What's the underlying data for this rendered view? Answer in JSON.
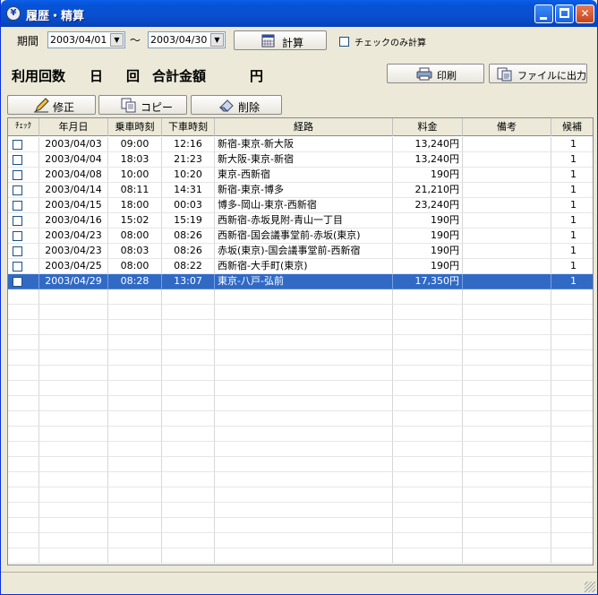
{
  "window": {
    "title": "履歴・精算",
    "app_icon": "¥"
  },
  "filter": {
    "period_label": "期間",
    "date_from": "2003/04/01",
    "range_sep": "〜",
    "date_to": "2003/04/30",
    "calc_button": "計算",
    "checked_only_label": "チェックのみ計算"
  },
  "summary": {
    "usage_count_label": "利用回数",
    "day_unit": "日",
    "times_unit": "回",
    "total_label": "合計金額",
    "yen_unit": "円"
  },
  "toolbar": {
    "print": "印刷",
    "export": "ファイルに出力",
    "edit": "修正",
    "copy": "コピー",
    "delete": "削除"
  },
  "grid": {
    "columns": [
      "ﾁｪｯｸ",
      "年月日",
      "乗車時刻",
      "下車時刻",
      "経路",
      "料金",
      "備考",
      "候補"
    ],
    "rows": [
      {
        "date": "2003/04/03",
        "board": "09:00",
        "alight": "12:16",
        "route": "新宿-東京-新大阪",
        "fare": "13,240円",
        "note": "",
        "cand": "1"
      },
      {
        "date": "2003/04/04",
        "board": "18:03",
        "alight": "21:23",
        "route": "新大阪-東京-新宿",
        "fare": "13,240円",
        "note": "",
        "cand": "1"
      },
      {
        "date": "2003/04/08",
        "board": "10:00",
        "alight": "10:20",
        "route": "東京-西新宿",
        "fare": "190円",
        "note": "",
        "cand": "1"
      },
      {
        "date": "2003/04/14",
        "board": "08:11",
        "alight": "14:31",
        "route": "新宿-東京-博多",
        "fare": "21,210円",
        "note": "",
        "cand": "1"
      },
      {
        "date": "2003/04/15",
        "board": "18:00",
        "alight": "00:03",
        "route": "博多-岡山-東京-西新宿",
        "fare": "23,240円",
        "note": "",
        "cand": "1"
      },
      {
        "date": "2003/04/16",
        "board": "15:02",
        "alight": "15:19",
        "route": "西新宿-赤坂見附-青山一丁目",
        "fare": "190円",
        "note": "",
        "cand": "1"
      },
      {
        "date": "2003/04/23",
        "board": "08:00",
        "alight": "08:26",
        "route": "西新宿-国会議事堂前-赤坂(東京)",
        "fare": "190円",
        "note": "",
        "cand": "1"
      },
      {
        "date": "2003/04/23",
        "board": "08:03",
        "alight": "08:26",
        "route": "赤坂(東京)-国会議事堂前-西新宿",
        "fare": "190円",
        "note": "",
        "cand": "1"
      },
      {
        "date": "2003/04/25",
        "board": "08:00",
        "alight": "08:22",
        "route": "西新宿-大手町(東京)",
        "fare": "190円",
        "note": "",
        "cand": "1"
      },
      {
        "date": "2003/04/29",
        "board": "08:28",
        "alight": "13:07",
        "route": "東京-八戸-弘前",
        "fare": "17,350円",
        "note": "",
        "cand": "1"
      }
    ],
    "selected_row": 9
  }
}
